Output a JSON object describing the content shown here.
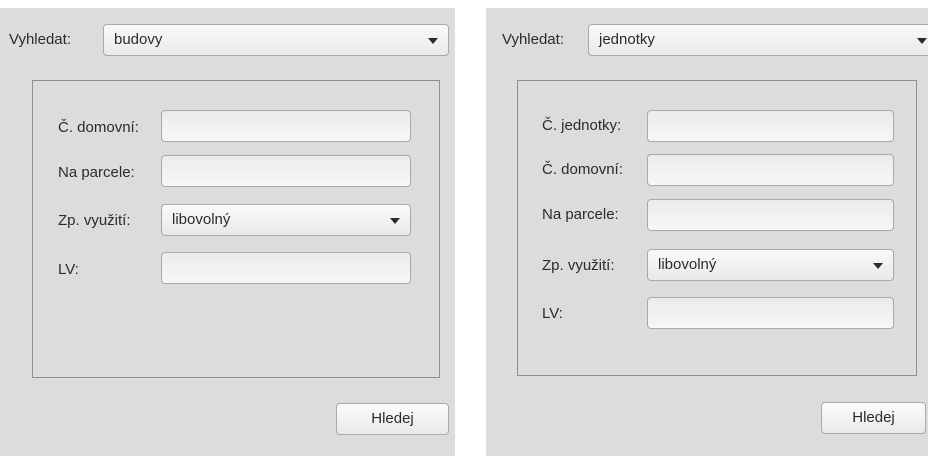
{
  "left": {
    "search_label": "Vyhledat:",
    "search_type": "budovy",
    "fields": [
      {
        "label": "Č. domovní:",
        "value": ""
      },
      {
        "label": "Na parcele:",
        "value": ""
      }
    ],
    "usage_label": "Zp. využití:",
    "usage_value": "libovolný",
    "lv_label": "LV:",
    "lv_value": "",
    "button": "Hledej"
  },
  "right": {
    "search_label": "Vyhledat:",
    "search_type": "jednotky",
    "fields": [
      {
        "label": "Č. jednotky:",
        "value": ""
      },
      {
        "label": "Č. domovní:",
        "value": ""
      },
      {
        "label": "Na parcele:",
        "value": ""
      }
    ],
    "usage_label": "Zp. využití:",
    "usage_value": "libovolný",
    "lv_label": "LV:",
    "lv_value": "",
    "button": "Hledej"
  }
}
